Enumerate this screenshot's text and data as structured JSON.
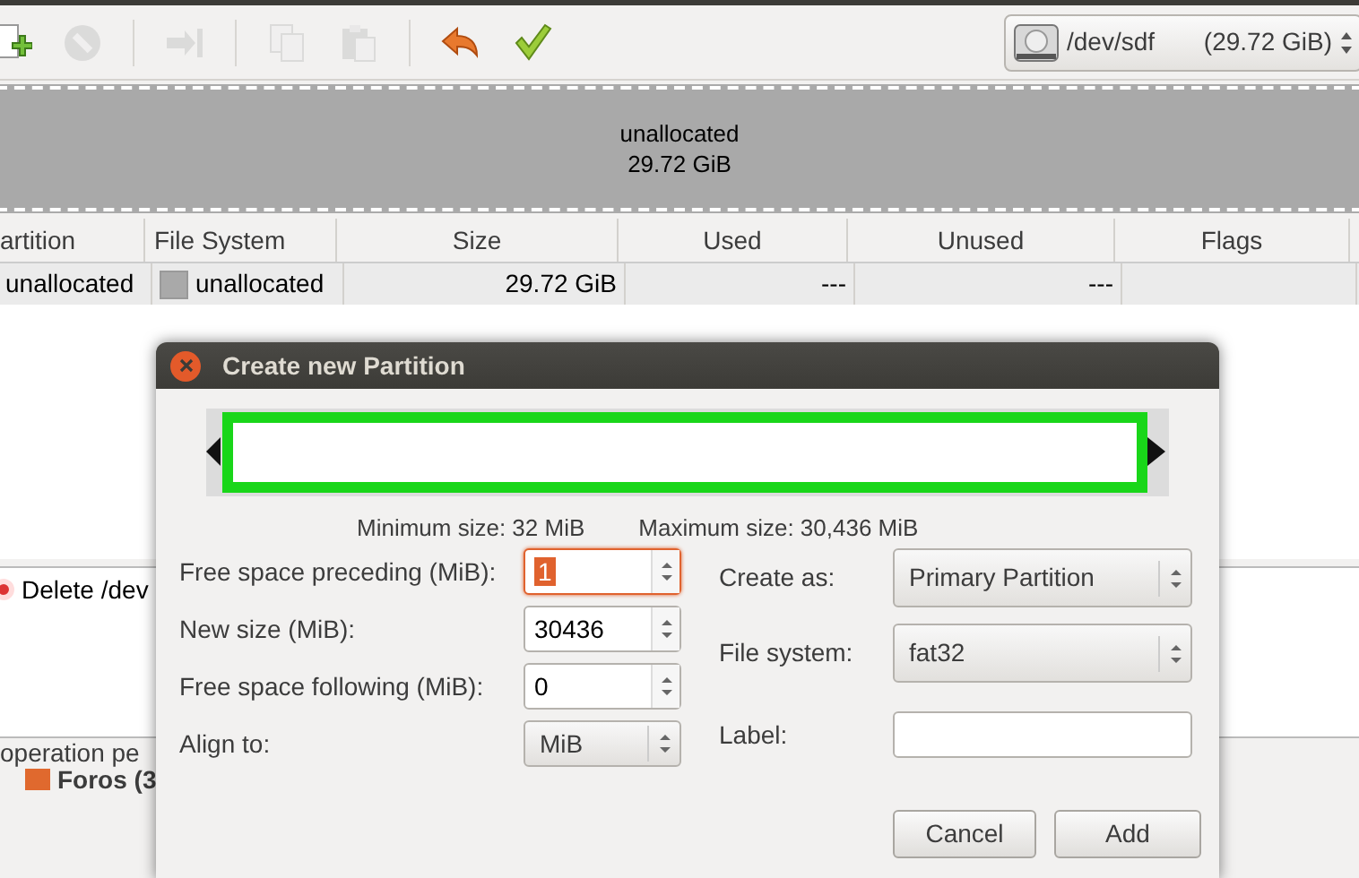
{
  "toolbar": {
    "tools": [
      {
        "kind": "new",
        "disabled": false
      },
      {
        "kind": "delete",
        "disabled": true
      },
      {
        "kind": "resize",
        "disabled": true
      },
      {
        "kind": "copy",
        "disabled": true
      },
      {
        "kind": "paste",
        "disabled": true
      },
      {
        "kind": "undo",
        "disabled": false
      },
      {
        "kind": "apply",
        "disabled": false
      }
    ],
    "device": {
      "name": "/dev/sdf",
      "size": "(29.72 GiB)"
    }
  },
  "disk_map": {
    "label": "unallocated",
    "size": "29.72 GiB"
  },
  "table": {
    "columns": [
      "artition",
      "File System",
      "Size",
      "Used",
      "Unused",
      "Flags"
    ],
    "rows": [
      {
        "partition": "unallocated",
        "file_system": "unallocated",
        "size": "29.72 GiB",
        "used": "---",
        "unused": "---"
      }
    ]
  },
  "operations": [
    "Delete /dev"
  ],
  "status_bar": "operation pe",
  "taskbar_item": "Foros (3",
  "dialog": {
    "title": "Create new Partition",
    "minimum": "Minimum size: 32 MiB",
    "maximum": "Maximum size: 30,436 MiB",
    "left_fields": [
      {
        "kind": "spin",
        "label": "Free space preceding (MiB):",
        "value": "1",
        "focused": true
      },
      {
        "kind": "spin",
        "label": "New size (MiB):",
        "value": "30436",
        "focused": false
      },
      {
        "kind": "spin",
        "label": "Free space following (MiB):",
        "value": "0",
        "focused": false
      },
      {
        "kind": "combo",
        "label": "Align to:",
        "value": "MiB"
      }
    ],
    "right_fields": [
      {
        "kind": "combo",
        "label": "Create as:",
        "value": "Primary Partition"
      },
      {
        "kind": "combo",
        "label": "File system:",
        "value": "fat32"
      },
      {
        "kind": "text",
        "label": "Label:"
      }
    ],
    "buttons": [
      "Cancel",
      "Add"
    ]
  }
}
